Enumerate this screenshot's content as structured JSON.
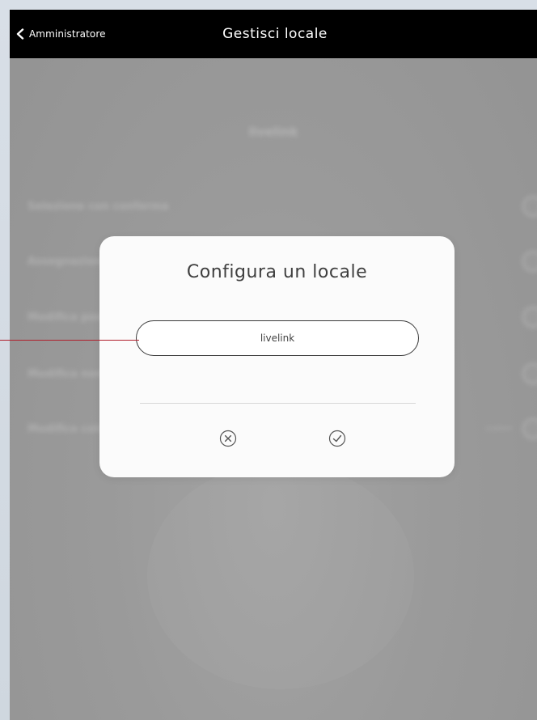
{
  "navbar": {
    "back_label": "Amministratore",
    "title": "Gestisci locale"
  },
  "background": {
    "heading": "livelink",
    "rows": [
      {
        "label": "Selezione con conferma"
      },
      {
        "label": "Assegnazione"
      },
      {
        "label": "Modifica posizione"
      },
      {
        "label": "Modifica nome"
      },
      {
        "label": "Modifica colore",
        "extra": "custom"
      }
    ]
  },
  "modal": {
    "title": "Configura un locale",
    "input_value": "livelink",
    "cancel_icon": "cancel-icon",
    "confirm_icon": "confirm-icon"
  },
  "colors": {
    "navbar": "#000000",
    "overlay": "#9a9a9a",
    "modal": "#fbfbfb",
    "callout": "#b01f2c"
  }
}
